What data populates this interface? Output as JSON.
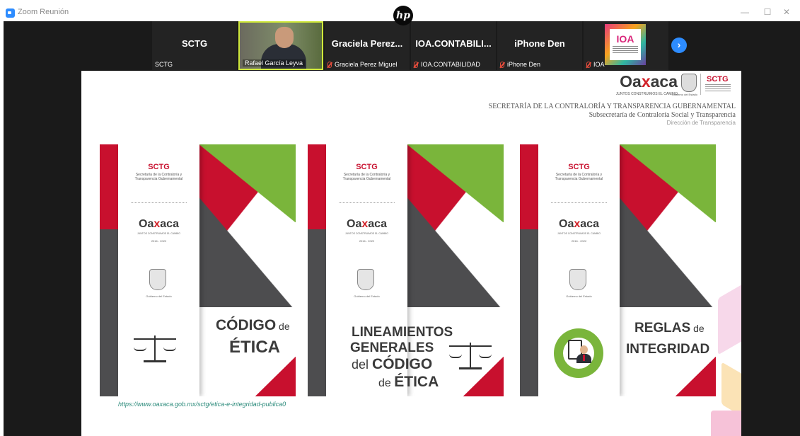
{
  "window": {
    "title": "Zoom Reunión",
    "controls": {
      "minimize": "—",
      "maximize": "☐",
      "close": "✕"
    },
    "hp_logo": "hp"
  },
  "participants": [
    {
      "display": "SCTG",
      "name": "SCTG",
      "muted": false,
      "video": false
    },
    {
      "display": "",
      "name": "Rafael García Leyva",
      "muted": false,
      "video": true
    },
    {
      "display": "Graciela Perez...",
      "name": "Graciela Perez Miguel",
      "muted": true,
      "video": false
    },
    {
      "display": "IOA.CONTABILI...",
      "name": "IOA.CONTABILIDAD",
      "muted": true,
      "video": false
    },
    {
      "display": "iPhone Den",
      "name": "iPhone Den",
      "muted": true,
      "video": false
    },
    {
      "display": "",
      "name": "IOA",
      "muted": true,
      "video": false,
      "logo_text": "IOA"
    }
  ],
  "next_button": "›",
  "slide": {
    "header": {
      "logo_text_pre": "Oa",
      "logo_text_x": "x",
      "logo_text_post": "aca",
      "logo_tagline": "JUNTOS CONSTRUIMOS EL CAMBIO",
      "coat_caption": "Gobierno del Estado",
      "sctg": "SCTG",
      "line1": "SECRETARÍA DE LA CONTRALORÍA Y TRANSPARENCIA GUBERNAMENTAL",
      "line2": "Subsecretaría de Contraloría Social y Transparencia",
      "line3": "Dirección de Transparencia"
    },
    "panel": {
      "sctg": "SCTG",
      "sctg_sub": "Secretaría de la Contraloría y Transparencia Gubernamental",
      "oax_pre": "Oa",
      "oax_x": "x",
      "oax_post": "aca",
      "oax_tagline": "JUNTOS CONSTRUIMOS EL CAMBIO",
      "years": "2016 - 2022",
      "gobierno": "Gobierno del Estado"
    },
    "covers": [
      {
        "title_a": "CÓDIGO",
        "title_a_small": " de",
        "title_b": "ÉTICA",
        "icon": "scales-icon"
      },
      {
        "line1": "LINEAMIENTOS",
        "line2": "GENERALES",
        "line3_small": "del ",
        "line3": "CÓDIGO",
        "line4_small": "de ",
        "line4": "ÉTICA",
        "icon": "scales-icon"
      },
      {
        "title_a": "REGLAS",
        "title_a_small": " de",
        "title_b": "INTEGRIDAD",
        "icon": "integrity-icon"
      }
    ],
    "url": "https://www.oaxaca.gob.mx/sctg/etica-e-integridad-publica0"
  },
  "colors": {
    "accent_red": "#c8102e",
    "accent_green": "#7ab53b",
    "dark_grey": "#4d4d4f",
    "zoom_blue": "#2d8cff"
  }
}
